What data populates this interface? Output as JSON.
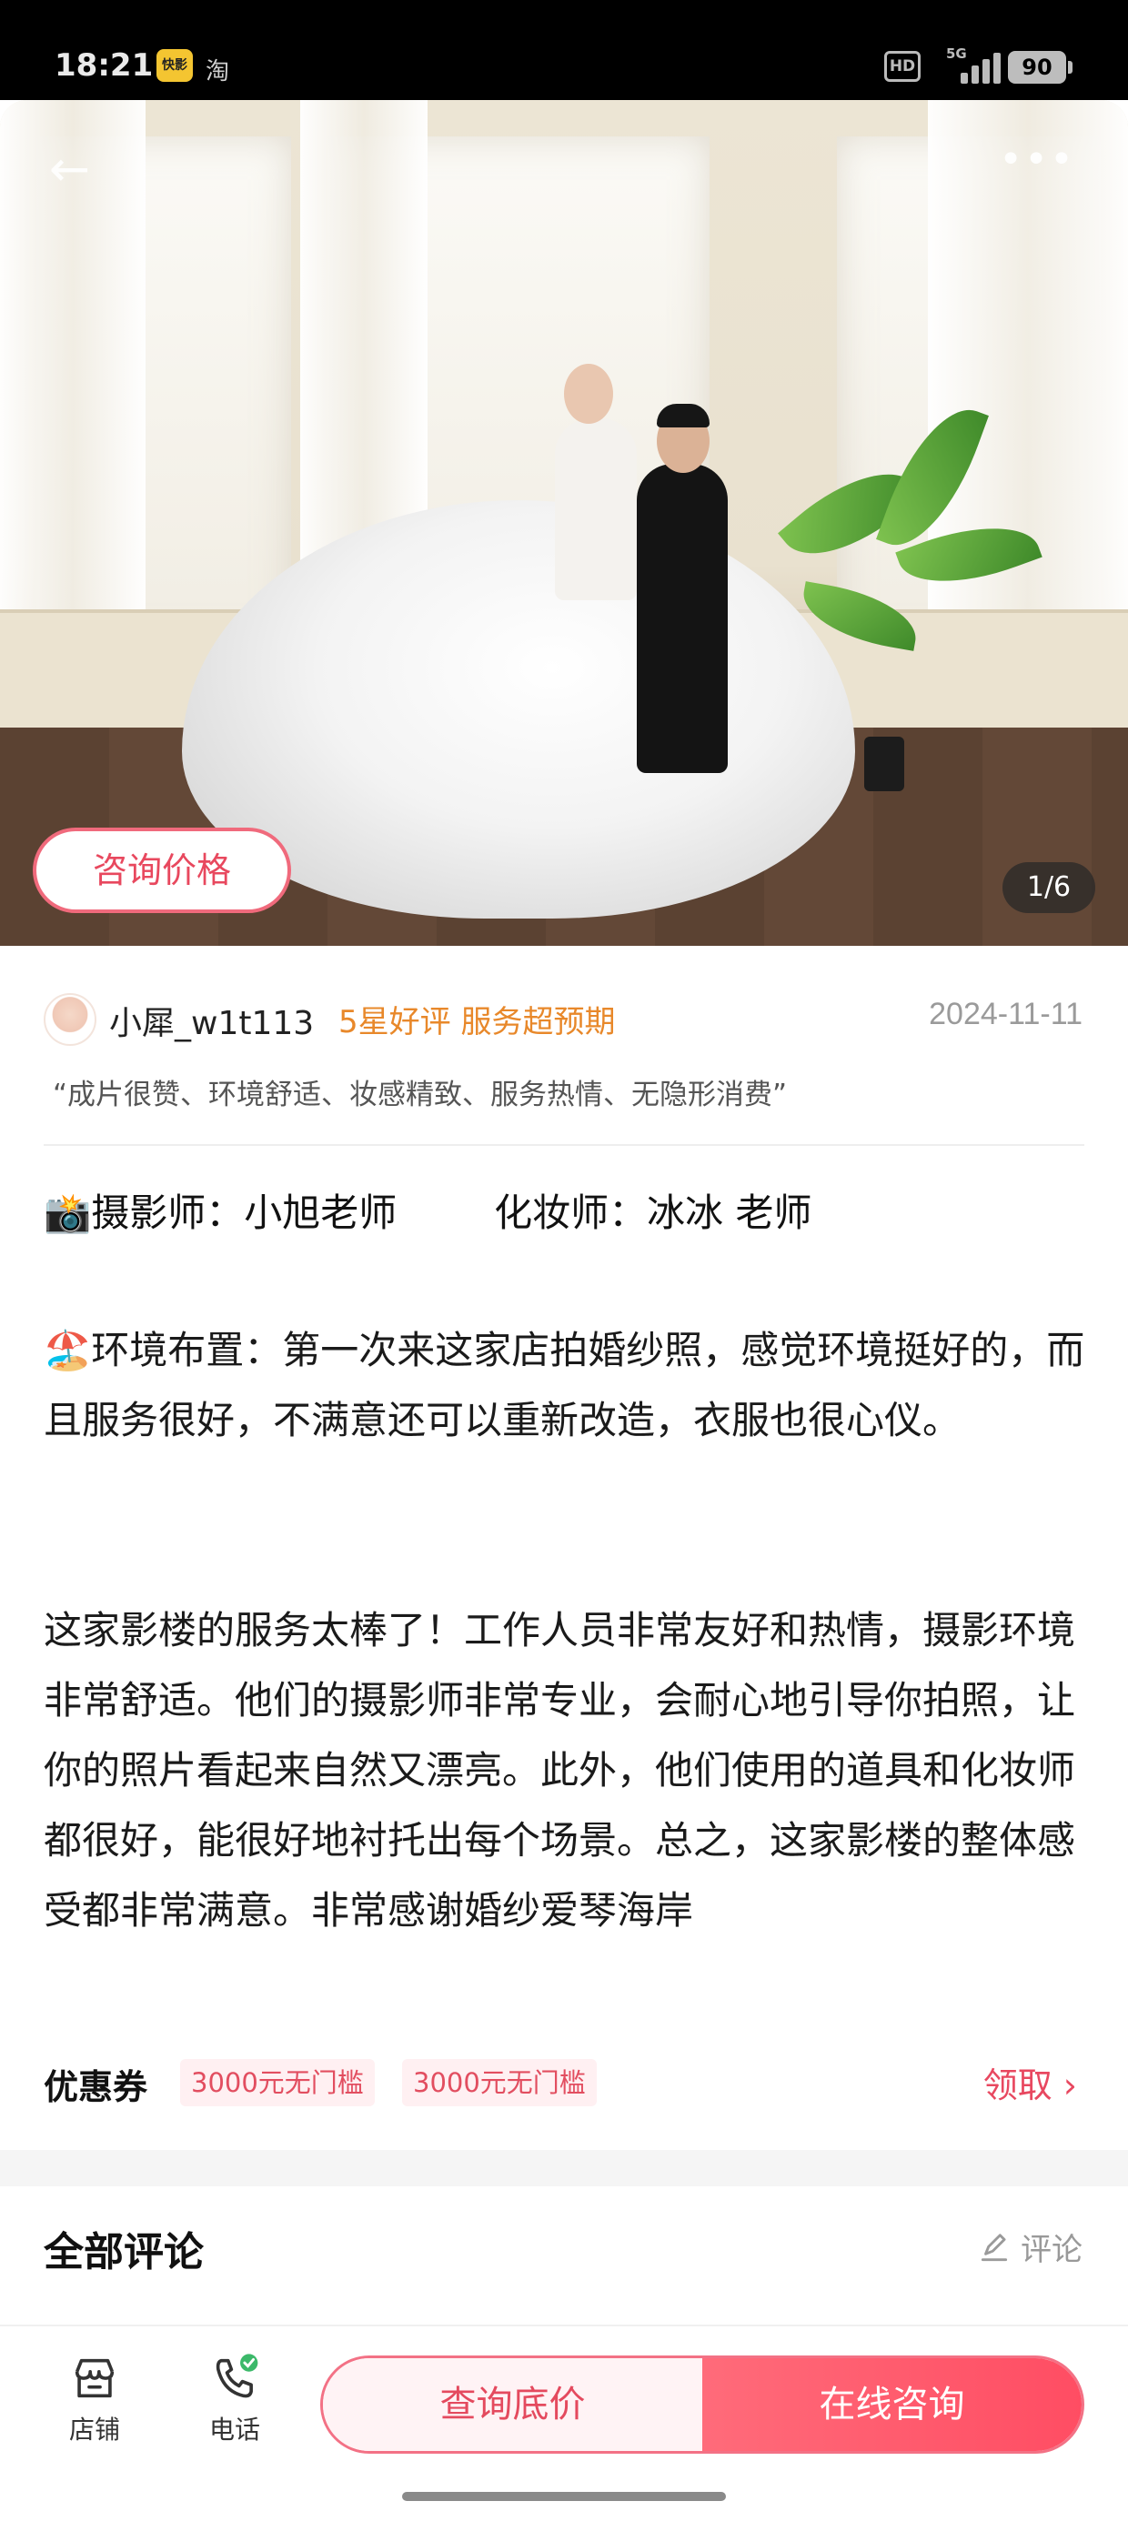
{
  "status_bar": {
    "time": "18:21",
    "app1": "快影",
    "app2": "淘",
    "hd": "HD",
    "network": "5G",
    "battery": "90"
  },
  "hero": {
    "consult_label": "咨询价格",
    "page_indicator": "1/6"
  },
  "review": {
    "username": "小犀_w1t113",
    "rating_tag": "5星好评 服务超预期",
    "date": "2024-11-11",
    "quote": "“成片很赞、环境舒适、妆感精致、服务热情、无隐形消费”",
    "credits": "📸摄影师：小旭老师        化妆师：冰冰 老师",
    "para1": "🏖️环境布置：第一次来这家店拍婚纱照，感觉环境挺好的，而且服务很好，不满意还可以重新改造，衣服也很心仪。",
    "para2": "这家影楼的服务太棒了！工作人员非常友好和热情，摄影环境非常舒适。他们的摄影师非常专业，会耐心地引导你拍照，让你的照片看起来自然又漂亮。此外，他们使用的道具和化妆师都很好，能很好地衬托出每个场景。总之，这家影楼的整体感受都非常满意。非常感谢婚纱爱琴海岸"
  },
  "coupons": {
    "label": "优惠券",
    "items": [
      "3000元无门槛",
      "3000元无门槛"
    ],
    "claim": "领取 ›"
  },
  "comments": {
    "title": "全部评论",
    "comment_button": "评论"
  },
  "bottom_bar": {
    "store_label": "店铺",
    "phone_label": "电话",
    "query_label": "查询底价",
    "online_label": "在线咨询"
  },
  "colors": {
    "accent": "#ff4d63",
    "rating": "#e8882a"
  }
}
